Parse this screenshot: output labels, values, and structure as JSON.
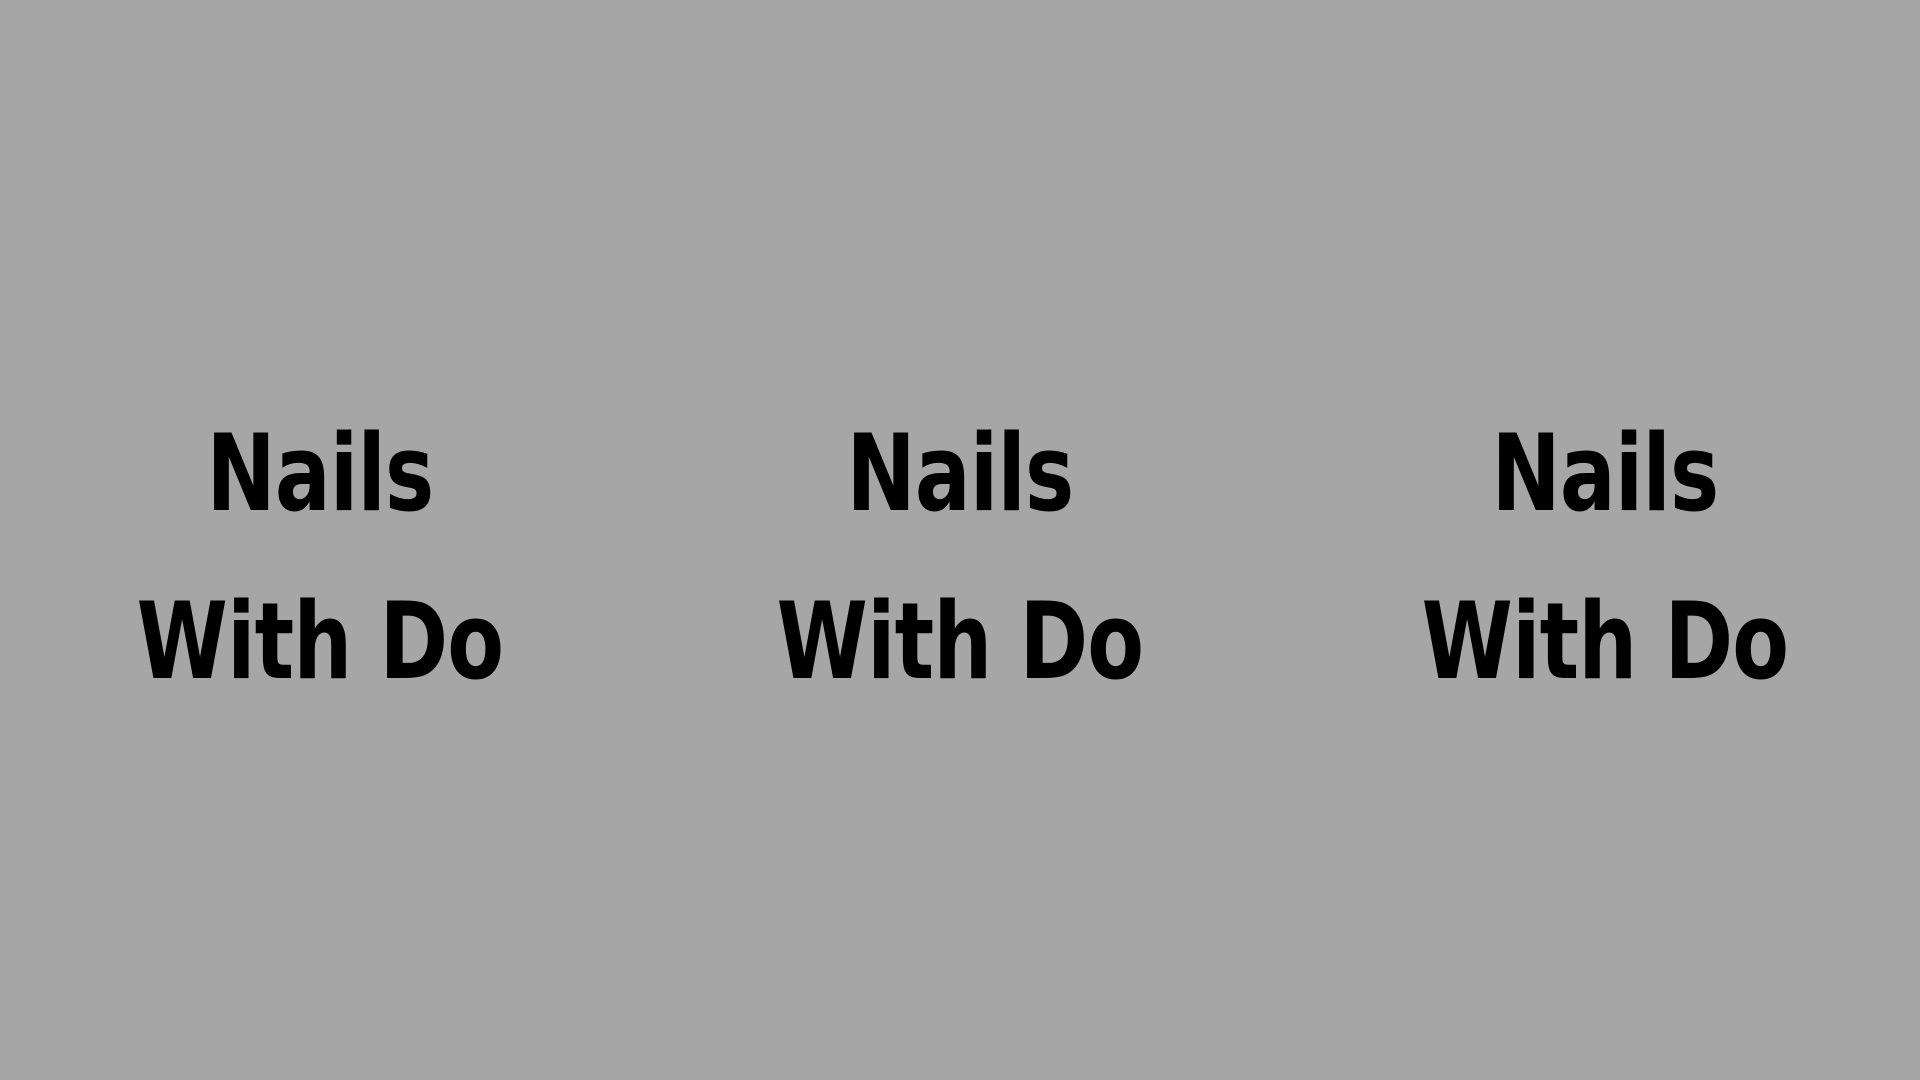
{
  "logos": [
    {
      "line1": "Nails",
      "line2": "With Do"
    },
    {
      "line1": "Nails",
      "line2": "With Do"
    },
    {
      "line1": "Nails",
      "line2": "With Do"
    }
  ],
  "colors": {
    "background": "#a6a6a6",
    "text": "#000000"
  }
}
